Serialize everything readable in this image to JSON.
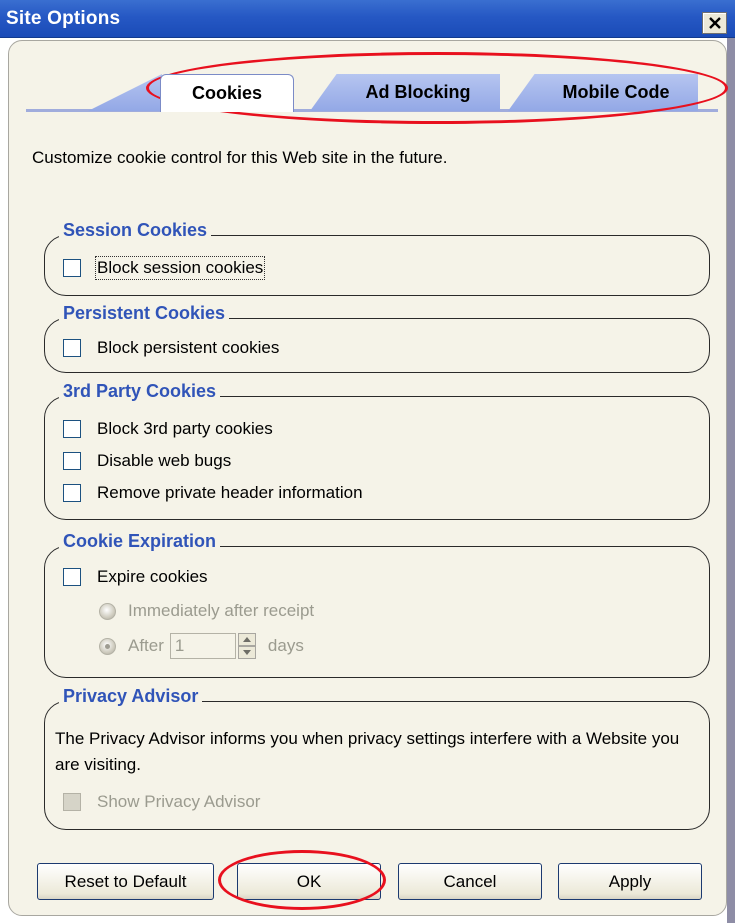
{
  "window": {
    "title": "Site Options"
  },
  "tabs": [
    {
      "label": "Cookies",
      "selected": true
    },
    {
      "label": "Ad Blocking",
      "selected": false
    },
    {
      "label": "Mobile Code",
      "selected": false
    }
  ],
  "intro": "Customize cookie control for this Web site in the future.",
  "groups": {
    "session": {
      "title": "Session Cookies",
      "items": [
        {
          "label": "Block session cookies",
          "checked": false
        }
      ]
    },
    "persistent": {
      "title": "Persistent Cookies",
      "items": [
        {
          "label": "Block persistent cookies",
          "checked": false
        }
      ]
    },
    "third_party": {
      "title": "3rd Party Cookies",
      "items": [
        {
          "label": "Block 3rd party cookies",
          "checked": false
        },
        {
          "label": "Disable web bugs",
          "checked": false
        },
        {
          "label": "Remove private header information",
          "checked": false
        }
      ]
    },
    "expiration": {
      "title": "Cookie Expiration",
      "expire_label": "Expire cookies",
      "immediately_label": "Immediately after receipt",
      "after_label": "After",
      "days_value": "1",
      "days_label": "days"
    },
    "advisor": {
      "title": "Privacy Advisor",
      "text": "The Privacy Advisor informs you when privacy settings interfere with a Website you are visiting.",
      "show_label": "Show Privacy Advisor"
    }
  },
  "buttons": {
    "reset": "Reset to Default",
    "ok": "OK",
    "cancel": "Cancel",
    "apply": "Apply"
  },
  "colors": {
    "title_bar": "#2658c4",
    "group_title": "#3054b8",
    "annotation": "#e8101e"
  }
}
